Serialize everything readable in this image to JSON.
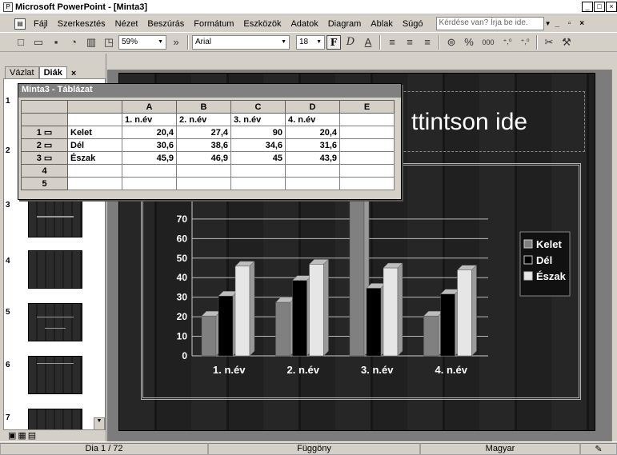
{
  "title": "Microsoft PowerPoint - [Minta3]",
  "window_buttons": [
    "_",
    "□",
    "×"
  ],
  "menu": [
    "Fájl",
    "Szerkesztés",
    "Nézet",
    "Beszúrás",
    "Formátum",
    "Eszközök",
    "Adatok",
    "Diagram",
    "Ablak",
    "Súgó"
  ],
  "help_placeholder": "Kérdése van? Írja be ide.",
  "toolbar": {
    "zoom": "59%",
    "font": "Arial",
    "size": "18",
    "bold": "F",
    "italic": "D",
    "underline": "A",
    "percent": "%",
    "thousands": "000"
  },
  "tabs": {
    "outline": "Vázlat",
    "slides": "Diák",
    "close": "×"
  },
  "thumbnails": [
    "1",
    "2",
    "3",
    "4",
    "5",
    "6",
    "7"
  ],
  "slide_title_fragment": "ttintson ide",
  "datasheet": {
    "title": "Minta3 - Táblázat",
    "columns": [
      "A",
      "B",
      "C",
      "D",
      "E"
    ],
    "headers": [
      "1. n.év",
      "2. n.év",
      "3. n.év",
      "4. n.év",
      ""
    ],
    "rows": [
      {
        "n": "1",
        "label": "Kelet",
        "vals": [
          "20,4",
          "27,4",
          "90",
          "20,4",
          ""
        ]
      },
      {
        "n": "2",
        "label": "Dél",
        "vals": [
          "30,6",
          "38,6",
          "34,6",
          "31,6",
          ""
        ]
      },
      {
        "n": "3",
        "label": "Észak",
        "vals": [
          "45,9",
          "46,9",
          "45",
          "43,9",
          ""
        ]
      },
      {
        "n": "4",
        "label": "",
        "vals": [
          "",
          "",
          "",
          "",
          ""
        ]
      },
      {
        "n": "5",
        "label": "",
        "vals": [
          "",
          "",
          "",
          "",
          ""
        ]
      }
    ]
  },
  "chart_data": {
    "type": "bar",
    "categories": [
      "1. n.év",
      "2. n.év",
      "3. n.év",
      "4. n.év"
    ],
    "series": [
      {
        "name": "Kelet",
        "values": [
          20.4,
          27.4,
          90,
          20.4
        ],
        "color": "#808080"
      },
      {
        "name": "Dél",
        "values": [
          30.6,
          38.6,
          34.6,
          31.6
        ],
        "color": "#000000"
      },
      {
        "name": "Észak",
        "values": [
          45.9,
          46.9,
          45,
          43.9
        ],
        "color": "#e6e6e6"
      }
    ],
    "yticks": [
      "0",
      "10",
      "20",
      "30",
      "40",
      "50",
      "60",
      "70"
    ],
    "ylim": [
      0,
      90
    ],
    "legend": "right",
    "grid": true
  },
  "status": {
    "slide": "Dia 1 / 72",
    "design": "Függöny",
    "language": "Magyar"
  }
}
